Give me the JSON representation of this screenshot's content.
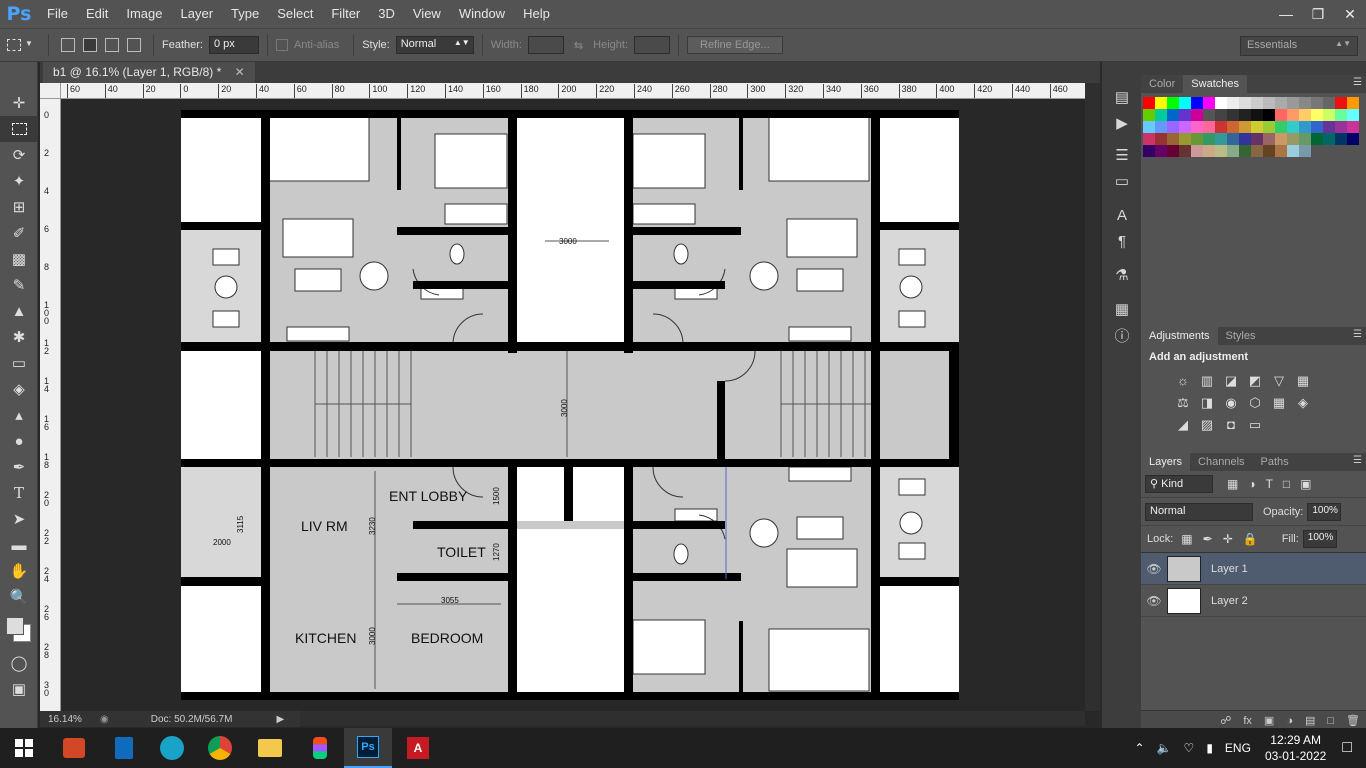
{
  "app": {
    "logo": "Ps"
  },
  "menu": [
    "File",
    "Edit",
    "Image",
    "Layer",
    "Type",
    "Select",
    "Filter",
    "3D",
    "View",
    "Window",
    "Help"
  ],
  "options": {
    "feather_label": "Feather:",
    "feather_value": "0 px",
    "antialias_label": "Anti-alias",
    "style_label": "Style:",
    "style_value": "Normal",
    "width_label": "Width:",
    "height_label": "Height:",
    "refine_label": "Refine Edge...",
    "workspace": "Essentials"
  },
  "document": {
    "tab_title": "b1 @ 16.1% (Layer 1, RGB/8) *",
    "zoom": "16.14%",
    "doc_size": "Doc: 50.2M/56.7M"
  },
  "rulers": {
    "top": [
      "60",
      "40",
      "20",
      "0",
      "20",
      "40",
      "60",
      "80",
      "100",
      "120",
      "140",
      "160",
      "180",
      "200",
      "220",
      "240",
      "260",
      "280",
      "300",
      "320",
      "340",
      "360",
      "380",
      "400",
      "420",
      "440",
      "460"
    ],
    "left": [
      "0",
      "2",
      "4",
      "6",
      "8",
      "1 0 0",
      "1 2",
      "1 4",
      "1 6",
      "1 8",
      "2 0",
      "2 2",
      "2 4",
      "2 6",
      "2 8",
      "3 0"
    ]
  },
  "floorplan": {
    "rooms": [
      "ENT LOBBY",
      "LIV RM",
      "TOILET",
      "KITCHEN",
      "BEDROOM"
    ],
    "dimensions": [
      "3000",
      "3000",
      "1500",
      "3115",
      "2000",
      "3230",
      "1270",
      "3055",
      "3000"
    ]
  },
  "swatches_panel": {
    "tabs": [
      "Color",
      "Swatches"
    ],
    "colors": [
      "#ff0000",
      "#ffff00",
      "#00ff00",
      "#00ffff",
      "#0000ff",
      "#ff00ff",
      "#ffffff",
      "#eeeeee",
      "#dddddd",
      "#cccccc",
      "#bbbbbb",
      "#aaaaaa",
      "#999999",
      "#888888",
      "#777777",
      "#666666",
      "#ee1111",
      "#ff9900",
      "#66cc00",
      "#00cc99",
      "#0066cc",
      "#6633cc",
      "#cc0099",
      "#555555",
      "#444444",
      "#333333",
      "#222222",
      "#111111",
      "#000000",
      "#ff6666",
      "#ff9966",
      "#ffcc66",
      "#ffff66",
      "#ccff66",
      "#66ff99",
      "#66ffff",
      "#66ccff",
      "#6699ff",
      "#9966ff",
      "#cc66ff",
      "#ff66cc",
      "#ff6699",
      "#cc3333",
      "#cc6633",
      "#cc9933",
      "#cccc33",
      "#99cc33",
      "#33cc66",
      "#33cccc",
      "#3399cc",
      "#3366cc",
      "#663399",
      "#993399",
      "#cc3399",
      "#cc3366",
      "#993333",
      "#996633",
      "#999933",
      "#669933",
      "#339966",
      "#339999",
      "#336699",
      "#333399",
      "#663366",
      "#996666",
      "#cc9966",
      "#999966",
      "#669966",
      "#006633",
      "#006666",
      "#003366",
      "#000066",
      "#330066",
      "#660066",
      "#660033",
      "#663333",
      "#cc9999",
      "#ccaa88",
      "#bbbb88",
      "#88aa88",
      "#336633",
      "#886644",
      "#664422",
      "#aa7744",
      "#99ccdd",
      "#7799aa"
    ]
  },
  "adjustments_panel": {
    "tabs": [
      "Adjustments",
      "Styles"
    ],
    "title": "Add an adjustment",
    "icons": [
      "☼",
      "▥",
      "◪",
      "◩",
      "▽",
      "▦",
      "⚖",
      "◨",
      "◉",
      "⬡",
      "▦",
      "◈",
      "◢",
      "▨",
      "◘",
      "▭"
    ]
  },
  "layers_panel": {
    "tabs": [
      "Layers",
      "Channels",
      "Paths"
    ],
    "filter_kind": "Kind",
    "blend_mode": "Normal",
    "opacity_label": "Opacity:",
    "opacity_value": "100%",
    "lock_label": "Lock:",
    "fill_label": "Fill:",
    "fill_value": "100%",
    "layers": [
      {
        "name": "Layer 1",
        "selected": true
      },
      {
        "name": "Layer 2",
        "selected": false
      }
    ]
  },
  "taskbar": {
    "time": "12:29 AM",
    "date": "03-01-2022",
    "lang": "ENG"
  },
  "colors": {
    "accent": "#4aa3ff",
    "panel": "#535353",
    "selected_layer": "#4f5b6e"
  }
}
